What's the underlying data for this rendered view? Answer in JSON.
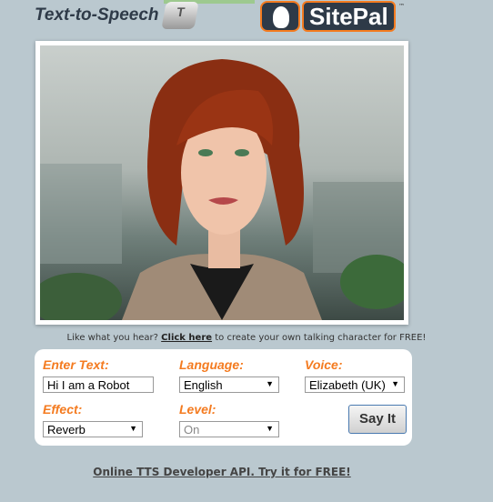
{
  "header": {
    "title": "Text-to-Speech",
    "key_letter": "T",
    "brand": "SitePal",
    "trademark": "™"
  },
  "promo": {
    "before": "Like what you hear? ",
    "link": "Click here",
    "after": " to create your own talking character for FREE!"
  },
  "form": {
    "text_label": "Enter Text:",
    "text_value": "Hi I am a Robot",
    "language_label": "Language:",
    "language_value": "English",
    "voice_label": "Voice:",
    "voice_value": "Elizabeth (UK)",
    "effect_label": "Effect:",
    "effect_value": "Reverb",
    "level_label": "Level:",
    "level_value": "On",
    "say_button": "Say It"
  },
  "footer": {
    "api_link": "Online TTS Developer API. Try it for FREE!"
  },
  "colors": {
    "accent": "#f47b20",
    "background": "#bac8cf"
  }
}
